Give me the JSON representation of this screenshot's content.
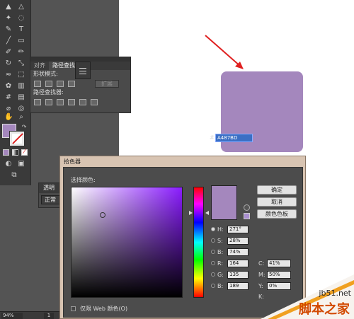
{
  "pathfinder": {
    "tab_align": "对齐",
    "tab_pathfinder": "路径查找器",
    "shape_modes_label": "形状模式:",
    "expand_label": "扩展",
    "pathfinders_label": "路径查找器:"
  },
  "transparency": {
    "tab": "透明",
    "mode": "正常"
  },
  "statusbar": {
    "zoom": "94%",
    "page": "1"
  },
  "picker": {
    "title": "拾色器",
    "select_color_label": "选择颜色:",
    "ok_label": "确定",
    "cancel_label": "取消",
    "swatches_label": "颜色色板",
    "web_only_label": "仅限 Web 颜色(O)",
    "hsb": [
      {
        "label": "H:",
        "value": "271°"
      },
      {
        "label": "S:",
        "value": "28%"
      },
      {
        "label": "B:",
        "value": "74%"
      }
    ],
    "rgb": [
      {
        "label": "R:",
        "value": "164"
      },
      {
        "label": "G:",
        "value": "135"
      },
      {
        "label": "B:",
        "value": "189"
      }
    ],
    "cmyk": [
      {
        "label": "C:",
        "value": "41%"
      },
      {
        "label": "M:",
        "value": "50%"
      },
      {
        "label": "Y:",
        "value": "0%"
      },
      {
        "label": "K:",
        "value": ""
      }
    ],
    "hex_prefix": "#",
    "hex": "A487BD"
  },
  "watermark": {
    "url": "jb51.net",
    "site": "脚本之家"
  },
  "colors": {
    "selected_fill": "#A487BD",
    "arrow": "#e02020",
    "workspace": "#545454"
  },
  "icons": [
    "selection-tool-icon",
    "pen-tool-icon",
    "type-tool-icon",
    "brush-tool-icon",
    "eyedropper-icon",
    "hand-tool-icon",
    "zoom-tool-icon",
    "menu-icon",
    "gamut-warning-icon"
  ]
}
